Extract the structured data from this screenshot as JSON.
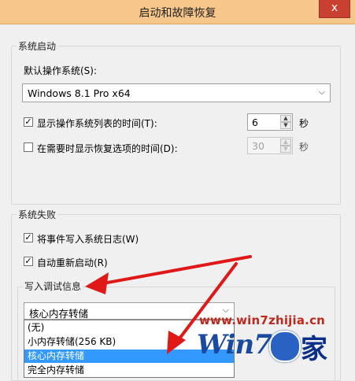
{
  "window": {
    "title": "启动和故障恢复",
    "close_glyph": "x"
  },
  "startup": {
    "group_label": "系统启动",
    "default_os_label": "默认操作系统(S):",
    "default_os_value": "Windows 8.1 Pro x64",
    "show_list": {
      "checked": true,
      "label": "显示操作系统列表的时间(T):",
      "value": "6",
      "unit": "秒"
    },
    "show_recovery": {
      "checked": false,
      "label": "在需要时显示恢复选项的时间(D):",
      "value": "30",
      "unit": "秒"
    }
  },
  "failure": {
    "group_label": "系统失败",
    "write_event": {
      "checked": true,
      "label": "将事件写入系统日志(W)"
    },
    "auto_restart": {
      "checked": true,
      "label": "自动重新启动(R)"
    },
    "debug_group_label": "写入调试信息",
    "debug_selected": "核心内存转储",
    "debug_options": [
      "(无)",
      "小内存转储(256 KB)",
      "核心内存转储",
      "完全内存转储"
    ],
    "debug_highlighted_index": 2
  },
  "watermark": {
    "url": "www.win7zhijia.cn",
    "logo_text_left": "Win7",
    "logo_text_right": "家"
  },
  "colors": {
    "titlebar": "#f6c68a",
    "close_button": "#c94030",
    "selection": "#3399ff",
    "annotation_arrow": "#e01818"
  }
}
